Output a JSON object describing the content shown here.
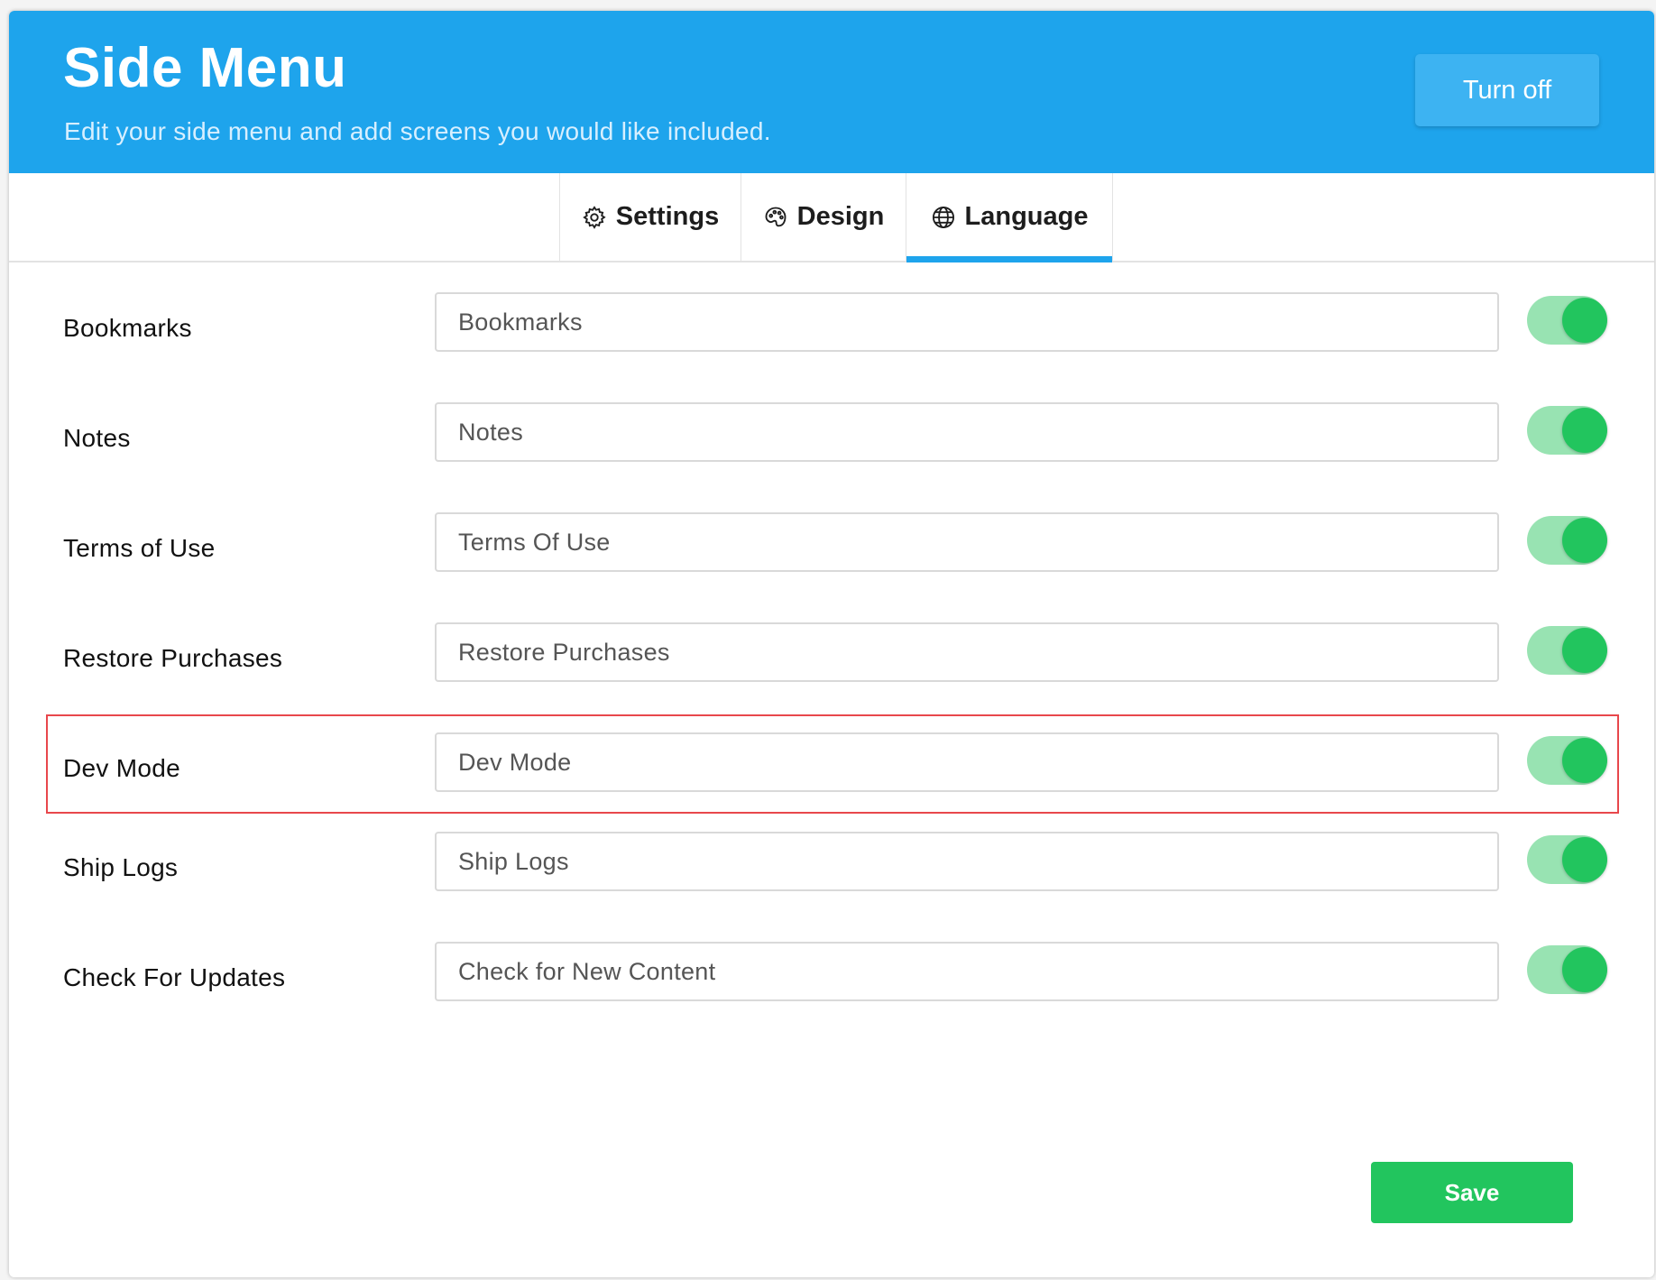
{
  "header": {
    "title": "Side Menu",
    "subtitle": "Edit your side menu and add screens you would like included.",
    "turn_off_label": "Turn off",
    "background_color": "#1ea4ec"
  },
  "tabs": [
    {
      "label": "Settings",
      "icon": "gear-icon",
      "active": false
    },
    {
      "label": "Design",
      "icon": "palette-icon",
      "active": false
    },
    {
      "label": "Language",
      "icon": "globe-icon",
      "active": true
    }
  ],
  "rows": [
    {
      "label": "Bookmarks",
      "value": "Bookmarks",
      "enabled": true
    },
    {
      "label": "Notes",
      "value": "Notes",
      "enabled": true
    },
    {
      "label": "Terms of Use",
      "value": "Terms Of Use",
      "enabled": true
    },
    {
      "label": "Restore Purchases",
      "value": "Restore Purchases",
      "enabled": true
    },
    {
      "label": "Dev Mode",
      "value": "Dev Mode",
      "enabled": true,
      "highlighted": true
    },
    {
      "label": "Ship Logs",
      "value": "Ship Logs",
      "enabled": true
    },
    {
      "label": "Check For Updates",
      "value": "Check for New Content",
      "enabled": true
    }
  ],
  "footer": {
    "save_label": "Save"
  },
  "colors": {
    "accent": "#1ea4ec",
    "success": "#22c55e",
    "toggle_track": "#98e3b2",
    "highlight": "#e8474c"
  }
}
